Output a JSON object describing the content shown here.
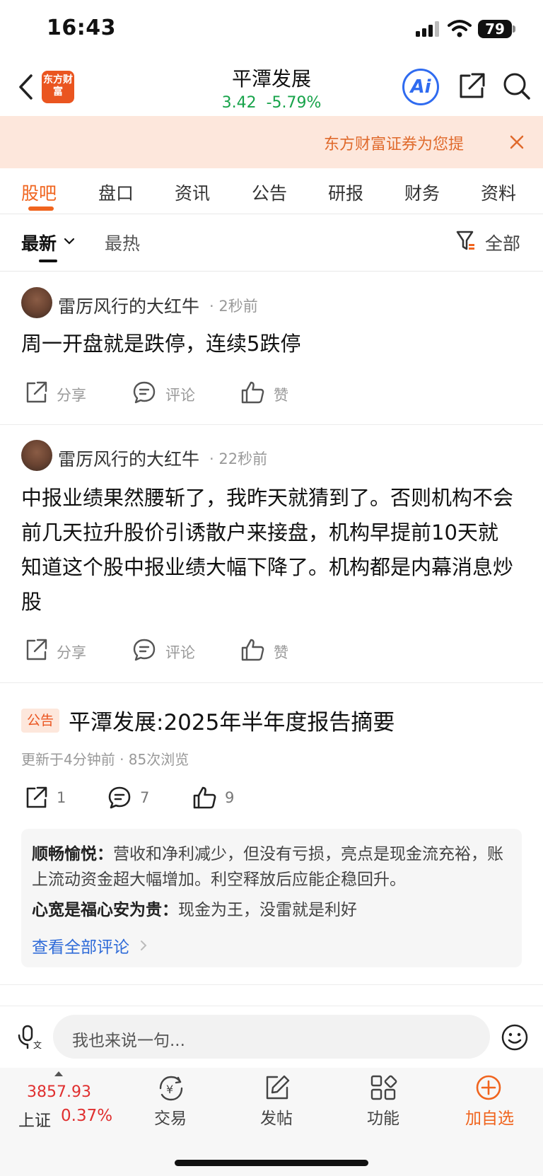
{
  "status_bar": {
    "time": "16:43",
    "battery": "79"
  },
  "header": {
    "logo_text": "东方财富",
    "stock_name": "平潭发展",
    "price": "3.42",
    "change": "-5.79%",
    "ai_label": "Ai"
  },
  "banner": {
    "text": "东方财富证券为您提"
  },
  "tabs": [
    {
      "label": "股吧"
    },
    {
      "label": "盘口"
    },
    {
      "label": "资讯"
    },
    {
      "label": "公告"
    },
    {
      "label": "研报"
    },
    {
      "label": "财务"
    },
    {
      "label": "资料"
    }
  ],
  "sort": {
    "latest": "最新",
    "hot": "最热",
    "filter": "全部"
  },
  "posts": [
    {
      "username": "雷厉风行的大红牛",
      "time": "· 2秒前",
      "text": "周一开盘就是跌停，连续5跌停",
      "share": "分享",
      "comment": "评论",
      "like": "赞"
    },
    {
      "username": "雷厉风行的大红牛",
      "time": "· 22秒前",
      "text": "中报业绩果然腰斩了，我昨天就猜到了。否则机构不会前几天拉升股价引诱散户来接盘，机构早提前10天就知道这个股中报业绩大幅下降了。机构都是内幕消息炒股",
      "share": "分享",
      "comment": "评论",
      "like": "赞"
    }
  ],
  "announcement": {
    "badge": "公告",
    "title": "平潭发展:2025年半年度报告摘要",
    "meta": "更新于4分钟前 · 85次浏览",
    "share_count": "1",
    "comment_count": "7",
    "like_count": "9",
    "comments": [
      {
        "user": "顺畅愉悦：",
        "text": "营收和净利减少，但没有亏损，亮点是现金流充裕，账上流动资金超大幅增加。利空释放后应能企稳回升。"
      },
      {
        "user": "心宽是福心安为贵：",
        "text": "现金为王，没雷就是利好"
      }
    ],
    "view_all": "查看全部评论"
  },
  "input": {
    "placeholder": "我也来说一句..."
  },
  "bottom_nav": {
    "index_value": "3857.93",
    "index_name": "上证",
    "index_change": "0.37%",
    "trade": "交易",
    "post": "发帖",
    "function": "功能",
    "add_watch": "加自选"
  },
  "colors": {
    "accent": "#f0641e",
    "down": "#17a34a",
    "up": "#e03030",
    "link": "#2f6bd8"
  }
}
